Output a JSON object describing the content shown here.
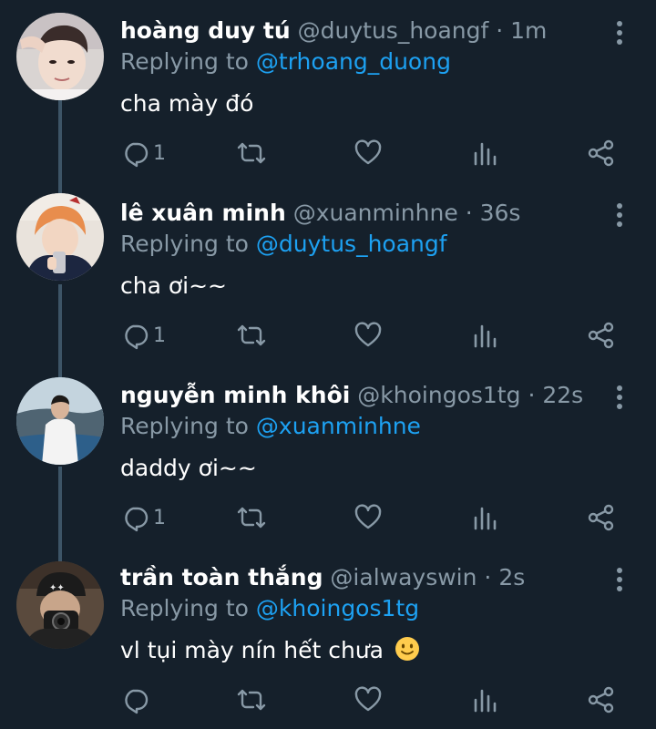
{
  "colors": {
    "background": "#15202b",
    "text_primary": "#ffffff",
    "text_secondary": "#8899a6",
    "mention": "#1da1f2",
    "thread_line": "#3d5466"
  },
  "tweets": [
    {
      "name": "hoàng duy tú",
      "handle": "@duytus_hoangf",
      "separator": "·",
      "time": "1m",
      "replying_prefix": "Replying to",
      "replying_to": "@trhoang_duong",
      "text": "cha mày đó",
      "reply_count": "1",
      "avatar_icon": "avatar-photo",
      "actions": [
        "reply-icon",
        "retweet-icon",
        "like-icon",
        "analytics-icon",
        "share-icon"
      ]
    },
    {
      "name": "lê xuân minh",
      "handle": "@xuanminhne",
      "separator": "·",
      "time": "36s",
      "replying_prefix": "Replying to",
      "replying_to": "@duytus_hoangf",
      "text": "cha ơi~~",
      "reply_count": "1",
      "avatar_icon": "avatar-photo",
      "actions": [
        "reply-icon",
        "retweet-icon",
        "like-icon",
        "analytics-icon",
        "share-icon"
      ]
    },
    {
      "name": "nguyễn minh khôi",
      "handle": "@khoingos1tg",
      "separator": "·",
      "time": "22s",
      "replying_prefix": "Replying to",
      "replying_to": "@xuanminhne",
      "text": "daddy ơi~~",
      "reply_count": "1",
      "avatar_icon": "avatar-photo",
      "actions": [
        "reply-icon",
        "retweet-icon",
        "like-icon",
        "analytics-icon",
        "share-icon"
      ]
    },
    {
      "name": "trần toàn thắng",
      "handle": "@ialwayswin",
      "separator": "·",
      "time": "2s",
      "replying_prefix": "Replying to",
      "replying_to": "@khoingos1tg",
      "text": "vl tụi mày nín hết chưa",
      "reply_count": "",
      "emoji": "slightly-smiling-face-emoji",
      "avatar_icon": "avatar-photo",
      "actions": [
        "reply-icon",
        "retweet-icon",
        "like-icon",
        "analytics-icon",
        "share-icon"
      ]
    }
  ]
}
